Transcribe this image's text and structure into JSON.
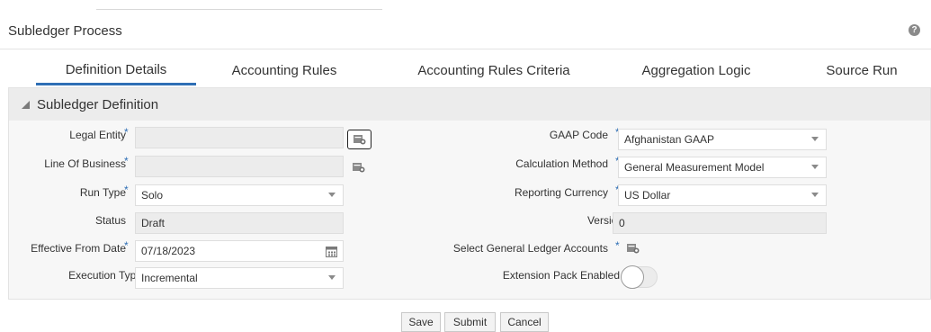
{
  "header": {
    "title": "Subledger Process",
    "help_icon": "help-icon",
    "help_glyph": "?"
  },
  "tabs": [
    {
      "label": "Definition Details",
      "active": true
    },
    {
      "label": "Accounting Rules",
      "active": false
    },
    {
      "label": "Accounting Rules Criteria",
      "active": false
    },
    {
      "label": "Aggregation Logic",
      "active": false
    },
    {
      "label": "Source Run",
      "active": false
    }
  ],
  "section": {
    "title": "Subledger Definition",
    "expanded": true
  },
  "fields": {
    "legal_entity": {
      "label": "Legal Entity",
      "required": true,
      "value": ""
    },
    "line_of_business": {
      "label": "Line Of Business",
      "required": true,
      "value": ""
    },
    "run_type": {
      "label": "Run Type",
      "required": true,
      "value": "Solo"
    },
    "status": {
      "label": "Status",
      "required": false,
      "value": "Draft"
    },
    "effective_from_date": {
      "label": "Effective From Date",
      "required": true,
      "value": "07/18/2023"
    },
    "execution_type": {
      "label": "Execution Type",
      "required": false,
      "value": "Incremental"
    },
    "gaap_code": {
      "label": "GAAP Code",
      "required": true,
      "value": "Afghanistan GAAP"
    },
    "calculation_method": {
      "label": "Calculation Method",
      "required": true,
      "value": "General Measurement Model"
    },
    "reporting_currency": {
      "label": "Reporting Currency",
      "required": true,
      "value": "US Dollar"
    },
    "version": {
      "label": "Version",
      "required": false,
      "value": "0"
    },
    "select_gl_accounts": {
      "label": "Select General Ledger Accounts",
      "required": true
    },
    "extension_pack": {
      "label": "Extension Pack Enabled",
      "enabled": false
    }
  },
  "required_mark": "*",
  "actions": {
    "save": "Save",
    "submit": "Submit",
    "cancel": "Cancel"
  },
  "colors": {
    "accent": "#2f6fb5",
    "panel": "#f7f7f7",
    "field": "#ececec"
  }
}
